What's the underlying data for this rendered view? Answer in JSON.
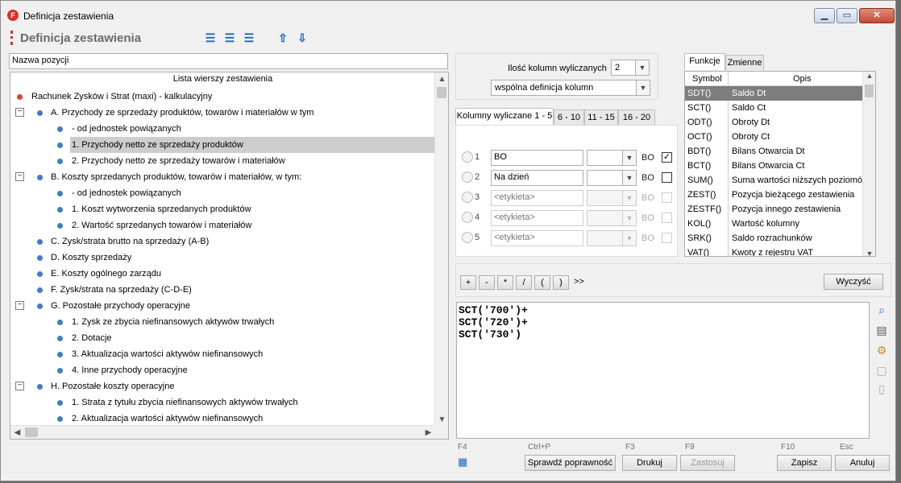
{
  "window": {
    "title": "Definicja zestawienia",
    "app_icon": "F"
  },
  "header": {
    "title": "Definicja zestawienia"
  },
  "toolbar_icons": [
    "add-item-icon",
    "edit-item-icon",
    "delete-item-icon",
    "move-up-icon",
    "move-down-icon"
  ],
  "name_field": {
    "value": "Nazwa pozycji"
  },
  "tree": {
    "header": "Lista wierszy zestawienia",
    "items": [
      {
        "label": "Rachunek Zysków i Strat (maxi) - kalkulacyjny",
        "level": 0,
        "root": true
      },
      {
        "label": "A. Przychody ze sprzedaży produktów, towarów i materiałów w tym",
        "level": 1,
        "expander": "−"
      },
      {
        "label": "- od jednostek powiązanych",
        "level": 2
      },
      {
        "label": "1. Przychody netto ze sprzedaży produktów",
        "level": 2,
        "selected": true
      },
      {
        "label": "2. Przychody netto ze sprzedaży towarów i materiałów",
        "level": 2
      },
      {
        "label": "B. Koszty sprzedanych produktów, towarów i materiałów, w tym:",
        "level": 1,
        "expander": "−"
      },
      {
        "label": "- od jednostek powiązanych",
        "level": 2
      },
      {
        "label": "1. Koszt wytworzenia sprzedanych produktów",
        "level": 2
      },
      {
        "label": "2. Wartość sprzedanych towarów i materiałów",
        "level": 2
      },
      {
        "label": "C. Zysk/strata brutto na sprzedaży (A-B)",
        "level": 1
      },
      {
        "label": "D. Koszty sprzedaży",
        "level": 1
      },
      {
        "label": "E. Koszty ogólnego zarządu",
        "level": 1
      },
      {
        "label": "F. Zysk/strata na sprzedaży (C-D-E)",
        "level": 1
      },
      {
        "label": "G. Pozostałe przychody operacyjne",
        "level": 1,
        "expander": "−"
      },
      {
        "label": "1. Zysk ze zbycia niefinansowych aktywów trwałych",
        "level": 2
      },
      {
        "label": "2. Dotacje",
        "level": 2
      },
      {
        "label": "3. Aktualizacja wartości aktywów niefinansowych",
        "level": 2
      },
      {
        "label": "4. Inne przychody operacyjne",
        "level": 2
      },
      {
        "label": "H. Pozostałe koszty operacyjne",
        "level": 1,
        "expander": "−"
      },
      {
        "label": "1. Strata z tytułu zbycia niefinansowych aktywów trwałych",
        "level": 2
      },
      {
        "label": "2. Aktualizacja wartości aktywów niefinansowych",
        "level": 2
      }
    ]
  },
  "columns": {
    "count_label": "Ilość kolumn wyliczanych",
    "count_value": "2",
    "definition_mode": "wspólna definicja kolumn",
    "tabs": [
      "Kolumny wyliczane 1 - 5",
      "6 - 10",
      "11 - 15",
      "16 - 20"
    ],
    "rows": [
      {
        "num": "1",
        "value": "BO",
        "bo": "BO",
        "checked": true,
        "enabled": true
      },
      {
        "num": "2",
        "value": "Na dzień",
        "bo": "BO",
        "checked": false,
        "enabled": true
      },
      {
        "num": "3",
        "value": "<etykieta>",
        "bo": "BO",
        "checked": false,
        "enabled": false
      },
      {
        "num": "4",
        "value": "<etykieta>",
        "bo": "BO",
        "checked": false,
        "enabled": false
      },
      {
        "num": "5",
        "value": "<etykieta>",
        "bo": "BO",
        "checked": false,
        "enabled": false
      }
    ]
  },
  "functions": {
    "tabs": [
      "Funkcje",
      "Zmienne"
    ],
    "headers": [
      "Symbol",
      "Opis"
    ],
    "rows": [
      {
        "symbol": "SDT()",
        "desc": "Saldo Dt",
        "selected": true
      },
      {
        "symbol": "SCT()",
        "desc": "Saldo Ct"
      },
      {
        "symbol": "ODT()",
        "desc": "Obroty Dt"
      },
      {
        "symbol": "OCT()",
        "desc": "Obroty Ct"
      },
      {
        "symbol": "BDT()",
        "desc": "Bilans Otwarcia Dt"
      },
      {
        "symbol": "BCT()",
        "desc": "Bilans Otwarcia Ct"
      },
      {
        "symbol": "SUM()",
        "desc": "Suma wartości niższych poziomów"
      },
      {
        "symbol": "ZEST()",
        "desc": "Pozycja bieżącego zestawienia"
      },
      {
        "symbol": "ZESTF()",
        "desc": "Pozycja innego zestawienia"
      },
      {
        "symbol": "KOL()",
        "desc": "Wartość kolumny"
      },
      {
        "symbol": "SRK()",
        "desc": "Saldo rozrachunków"
      },
      {
        "symbol": "VAT()",
        "desc": "Kwoty z rejestru VAT"
      }
    ]
  },
  "operators": [
    "+",
    "-",
    "*",
    "/",
    "(",
    ")"
  ],
  "more_label": ">>",
  "clear_button": "Wyczyść",
  "formula": [
    "SCT('700')+",
    "SCT('720')+",
    "SCT('730')"
  ],
  "side_icons": [
    "search-icon",
    "list-icon",
    "settings-icon",
    "paste-icon",
    "copy-icon"
  ],
  "footer": {
    "f4": "F4",
    "check": {
      "key": "Ctrl+P",
      "label": "Sprawdź poprawność"
    },
    "print": {
      "key": "F3",
      "label": "Drukuj"
    },
    "apply": {
      "key": "F9",
      "label": "Zastosuj"
    },
    "save": {
      "key": "F10",
      "label": "Zapisz"
    },
    "cancel": {
      "key": "Esc",
      "label": "Anuluj"
    }
  }
}
